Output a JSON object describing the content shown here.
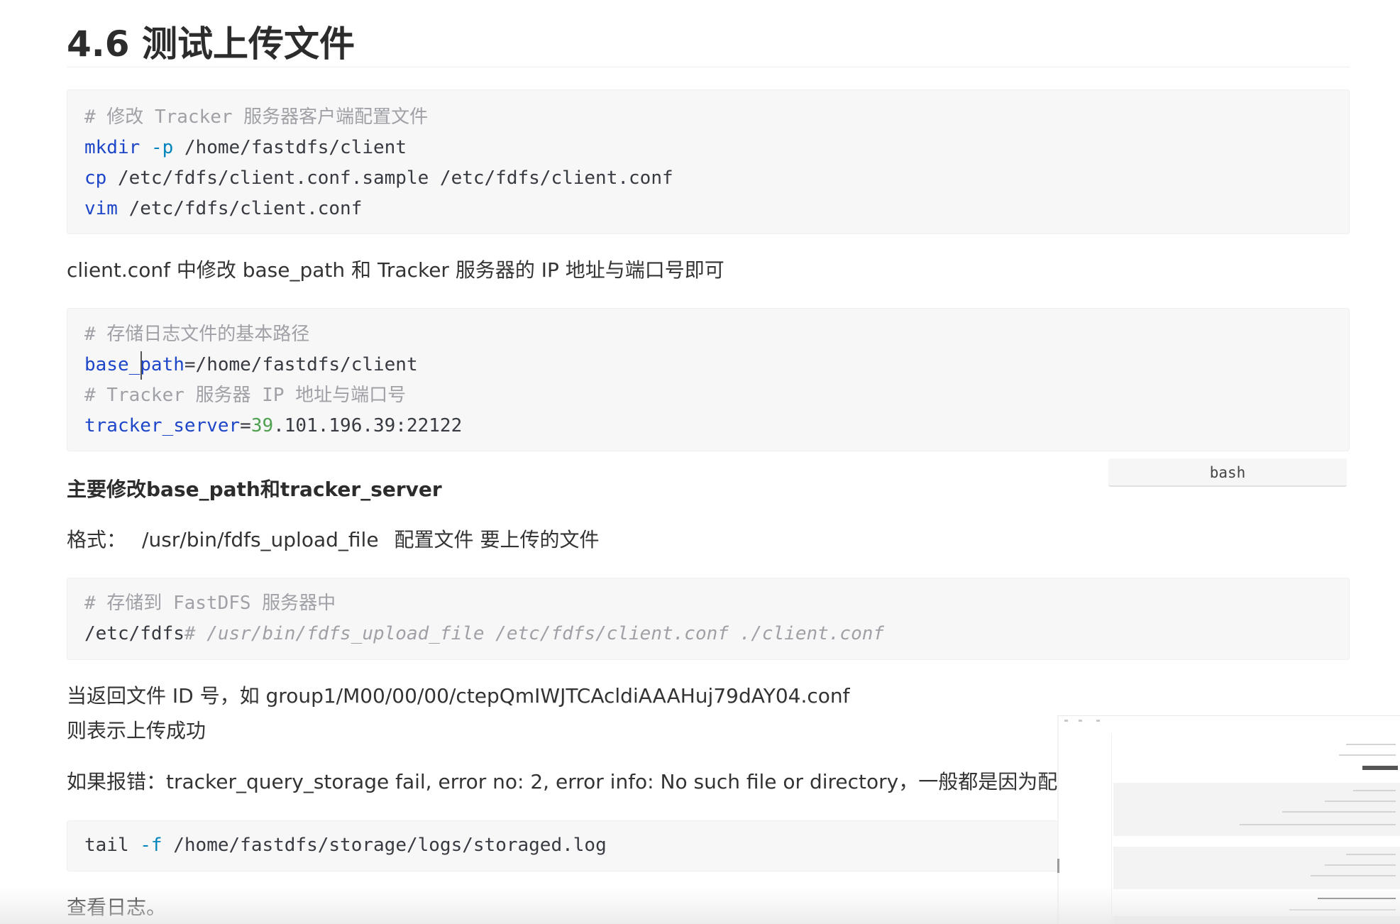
{
  "section": {
    "title": "4.6 测试上传文件"
  },
  "code_block_1": {
    "comment": "# 修改 Tracker 服务器客户端配置文件",
    "line1_cmd": "mkdir",
    "line1_flag": "-p",
    "line1_arg": "/home/fastdfs/client",
    "line2_cmd": "cp",
    "line2_arg": "/etc/fdfs/client.conf.sample /etc/fdfs/client.conf",
    "line3_cmd": "vim",
    "line3_arg": "/etc/fdfs/client.conf"
  },
  "para_1": "client.conf 中修改 base_path 和 Tracker 服务器的 IP 地址与端口号即可",
  "code_block_2": {
    "comment1": "# 存储日志文件的基本路径",
    "base_path_key": "base_path",
    "base_path_val": "=/home/fastdfs/client",
    "comment2": "# Tracker 服务器 IP 地址与端口号",
    "tracker_key": "tracker_server",
    "tracker_eq": "=",
    "tracker_num": "39",
    "tracker_rest": ".101.196.39:22122"
  },
  "code_lang_label": "bash",
  "para_bold": "主要修改base_path和tracker_server",
  "para_format": {
    "label": "格式：",
    "cmd": "/usr/bin/fdfs_upload_file",
    "args": "配置文件 要上传的文件"
  },
  "code_block_3": {
    "comment": "# 存储到 FastDFS 服务器中",
    "prompt": "/etc/fdfs",
    "command": "# /usr/bin/fdfs_upload_file /etc/fdfs/client.conf ./client.conf"
  },
  "para_result_1": "当返回文件 ID 号，如 group1/M00/00/00/ctepQmIWJTCAcldiAAAHuj79dAY04.conf",
  "para_result_2": "则表示上传成功",
  "para_error": "如果报错：tracker_query_storage fail, error no: 2, error info: No such file or directory，一般都是因为配",
  "code_block_4": {
    "cmd": "tail",
    "flag": "-f",
    "arg": "/home/fastdfs/storage/logs/storaged.log"
  },
  "para_log": "查看日志。"
}
